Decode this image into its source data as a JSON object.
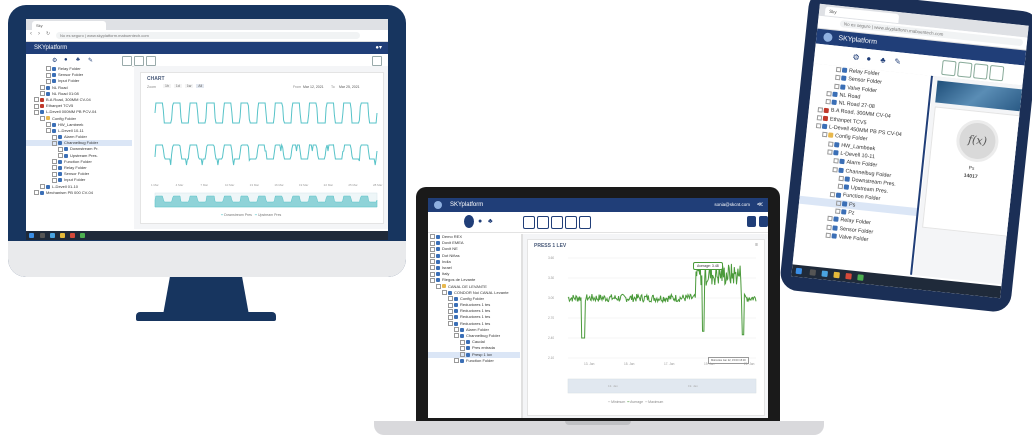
{
  "desktop": {
    "browser": {
      "tab_title": "Sky",
      "url": "No es seguro | www.skyplatform.mabuentech.com"
    },
    "app_title": "SKYplatform",
    "toolbar_icons": [
      "gear-icon",
      "drop-icon",
      "people-icon",
      "wrench-icon"
    ],
    "tree": [
      {
        "label": "Relay Folder",
        "indent": 3,
        "icon": "box"
      },
      {
        "label": "Sensor Folder",
        "indent": 3,
        "icon": "box"
      },
      {
        "label": "Input Folder",
        "indent": 3,
        "icon": "box"
      },
      {
        "label": "NL Road",
        "indent": 2,
        "icon": "box"
      },
      {
        "label": "NL Road 01:08",
        "indent": 2,
        "icon": "box"
      },
      {
        "label": "B.A Road, 300MM CV-04",
        "indent": 1,
        "icon": "red"
      },
      {
        "label": "Ethanpet TCV5",
        "indent": 1,
        "icon": "red"
      },
      {
        "label": "L-Devell 000MM PB PCV-04",
        "indent": 1,
        "icon": "box"
      },
      {
        "label": "Config Folder",
        "indent": 2,
        "icon": "folder"
      },
      {
        "label": "HW_Lambeek",
        "indent": 3,
        "icon": "box"
      },
      {
        "label": "L-Devell 10-11",
        "indent": 3,
        "icon": "box"
      },
      {
        "label": "Alarm Folder",
        "indent": 4,
        "icon": "box"
      },
      {
        "label": "Channelbug Folder",
        "indent": 4,
        "icon": "box",
        "selected": true
      },
      {
        "label": "Downstream Pr.",
        "indent": 5,
        "icon": "box"
      },
      {
        "label": "Upstream Pres.",
        "indent": 5,
        "icon": "box"
      },
      {
        "label": "Function Folder",
        "indent": 4,
        "icon": "box"
      },
      {
        "label": "Relay Folder",
        "indent": 4,
        "icon": "box"
      },
      {
        "label": "Sensor Folder",
        "indent": 4,
        "icon": "box"
      },
      {
        "label": "Input Folder",
        "indent": 4,
        "icon": "box"
      },
      {
        "label": "L-Devell 01-10",
        "indent": 2,
        "icon": "box"
      },
      {
        "label": "Mechanism PB 000 CV-04",
        "indent": 1,
        "icon": "box"
      }
    ],
    "chart_card_title": "CHART",
    "chart_toolbar": {
      "zoom_label": "Zoom",
      "range_buttons": [
        "1h",
        "1d",
        "1w",
        "All"
      ],
      "from_label": "From",
      "from_value": "Mar 12, 2021",
      "to_label": "To",
      "to_value": "Mar 25, 2021"
    },
    "x_ticks": [
      "1 Mar",
      "4 Mar",
      "7 Mar",
      "10 Mar",
      "13 Mar",
      "16 Mar",
      "19 Mar",
      "22 Mar",
      "25 Mar",
      "28 Mar"
    ],
    "legend": [
      "Downstream Pres",
      "Upstream Pres"
    ],
    "colors": {
      "navy": "#203e78",
      "teal": "#57c3c8"
    }
  },
  "laptop": {
    "app_title": "SKYplatform",
    "user_email": "sonia@skcnt.com",
    "tree": [
      {
        "label": "Demo REX",
        "indent": 0,
        "icon": "box"
      },
      {
        "label": "Dovit EMEA",
        "indent": 0,
        "icon": "box"
      },
      {
        "label": "Dovit NE",
        "indent": 0,
        "icon": "box"
      },
      {
        "label": "Dot Niñas",
        "indent": 0,
        "icon": "box"
      },
      {
        "label": "India",
        "indent": 0,
        "icon": "box"
      },
      {
        "label": "Israel",
        "indent": 0,
        "icon": "box"
      },
      {
        "label": "Italy",
        "indent": 0,
        "icon": "box"
      },
      {
        "label": "Riegos de Levante",
        "indent": 0,
        "icon": "box"
      },
      {
        "label": "CANAL DE LEVANTE",
        "indent": 1,
        "icon": "folder"
      },
      {
        "label": "CONDOR Noi CANAL Levante",
        "indent": 2,
        "icon": "box"
      },
      {
        "label": "Config Folder",
        "indent": 3,
        "icon": "box"
      },
      {
        "label": "Reductores 1 tes",
        "indent": 3,
        "icon": "box"
      },
      {
        "label": "Reductores 1 tes",
        "indent": 3,
        "icon": "box"
      },
      {
        "label": "Reductores 1 tes",
        "indent": 3,
        "icon": "box"
      },
      {
        "label": "Reductores 1 tes",
        "indent": 3,
        "icon": "box"
      },
      {
        "label": "Alarm Folder",
        "indent": 4,
        "icon": "box"
      },
      {
        "label": "Channelbug Folder",
        "indent": 4,
        "icon": "box"
      },
      {
        "label": "Caudal",
        "indent": 5,
        "icon": "box"
      },
      {
        "label": "Pres entrada",
        "indent": 5,
        "icon": "box"
      },
      {
        "label": "Presp 1 lov",
        "indent": 5,
        "icon": "box",
        "selected": true
      },
      {
        "label": "Function Folder",
        "indent": 4,
        "icon": "box"
      }
    ],
    "chart_title": "PRESS 1 LEV",
    "tooltip": "Average: 3.48",
    "tooltip_date": "Miércoles Jan 22, 15:00 15:30",
    "y_ticks": [
      "3.60",
      "3.30",
      "3.00",
      "2.70",
      "2.40",
      "2.10"
    ],
    "x_ticks": [
      "13. Jan",
      "15. Jan",
      "17. Jan",
      "19. Jan",
      "21. Jan"
    ],
    "navigator_ticks": [
      "13. Jan",
      "19. Jan"
    ],
    "legend": [
      "Minimum",
      "Average",
      "Maximum"
    ],
    "colors": {
      "line": "#4a9a3a",
      "navy": "#203e78"
    }
  },
  "tablet": {
    "browser": {
      "tab_title": "Sky",
      "url": "No es seguro | www.skyplatform.mabuentech.com"
    },
    "app_title": "SKYplatform",
    "tree": [
      {
        "label": "Relay Folder",
        "indent": 3,
        "icon": "box"
      },
      {
        "label": "Sensor Folder",
        "indent": 3,
        "icon": "box"
      },
      {
        "label": "Valve Folder",
        "indent": 3,
        "icon": "box"
      },
      {
        "label": "NL Road",
        "indent": 2,
        "icon": "box"
      },
      {
        "label": "NL Road 27-08",
        "indent": 2,
        "icon": "box"
      },
      {
        "label": "B.A Road, 300MM CV-04",
        "indent": 1,
        "icon": "red"
      },
      {
        "label": "Ethanpet TCV5",
        "indent": 1,
        "icon": "red"
      },
      {
        "label": "L-Devell 450MM PB PS CV-04",
        "indent": 1,
        "icon": "box"
      },
      {
        "label": "Config Folder",
        "indent": 2,
        "icon": "folder"
      },
      {
        "label": "HW_Lambeek",
        "indent": 3,
        "icon": "box"
      },
      {
        "label": "L-Devell 10-11",
        "indent": 3,
        "icon": "box"
      },
      {
        "label": "Alarm Folder",
        "indent": 4,
        "icon": "box"
      },
      {
        "label": "Channelbug Folder",
        "indent": 4,
        "icon": "box"
      },
      {
        "label": "Downstream Pres.",
        "indent": 5,
        "icon": "box"
      },
      {
        "label": "Upstream Pres.",
        "indent": 5,
        "icon": "box"
      },
      {
        "label": "Function Folder",
        "indent": 4,
        "icon": "box"
      },
      {
        "label": "Ps",
        "indent": 5,
        "icon": "box",
        "selected": true
      },
      {
        "label": "Pz",
        "indent": 5,
        "icon": "box"
      },
      {
        "label": "Relay Folder",
        "indent": 4,
        "icon": "box"
      },
      {
        "label": "Sensor Folder",
        "indent": 4,
        "icon": "box"
      },
      {
        "label": "Valve Folder",
        "indent": 4,
        "icon": "box"
      }
    ],
    "function_symbol": "f(x)",
    "function_name": "Ps",
    "function_value": "14017"
  }
}
